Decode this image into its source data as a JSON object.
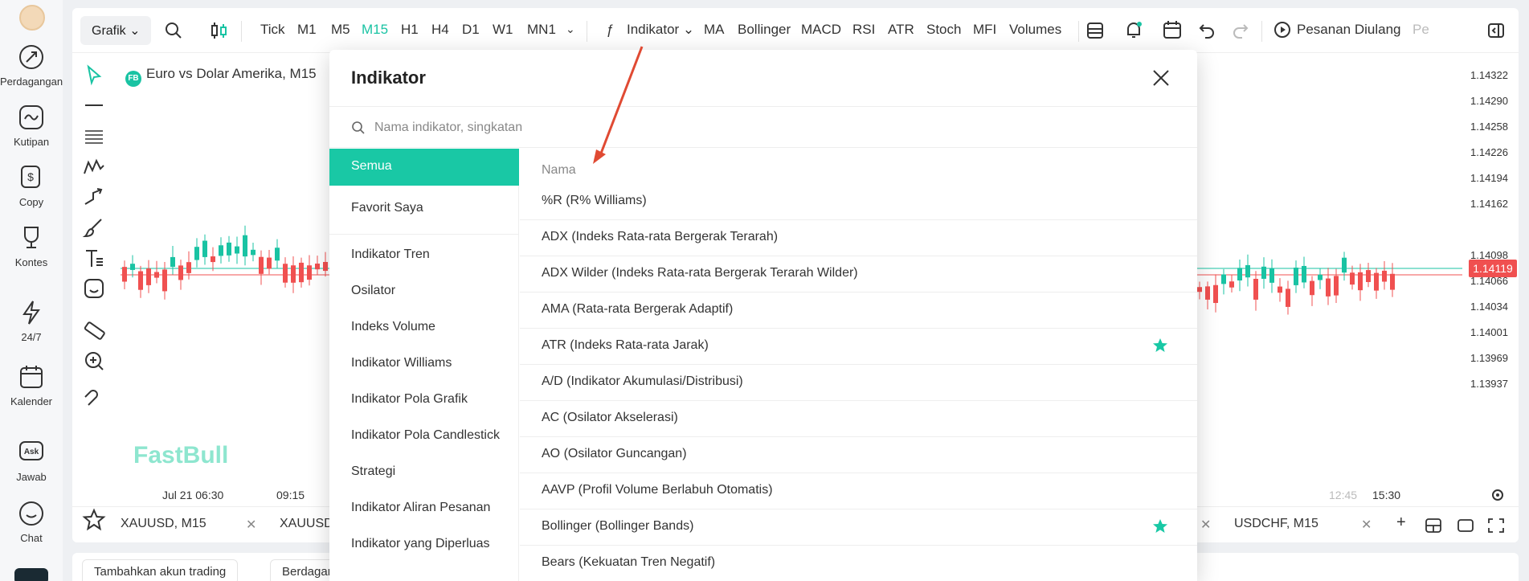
{
  "app_sidebar": {
    "items": [
      {
        "label": "Perdagangan",
        "icon": "trade-compass-icon"
      },
      {
        "label": "Kutipan",
        "icon": "quote-chart-icon"
      },
      {
        "label": "Copy",
        "icon": "copy-dollar-icon"
      },
      {
        "label": "Kontes",
        "icon": "trophy-icon"
      },
      {
        "label": "24/7",
        "icon": "lightning-icon"
      },
      {
        "label": "Kalender",
        "icon": "calendar-icon"
      },
      {
        "label": "Jawab",
        "icon": "ask-icon"
      },
      {
        "label": "Chat",
        "icon": "chat-icon"
      }
    ]
  },
  "toolbar": {
    "grafik": "Grafik",
    "timeframes": [
      "Tick",
      "M1",
      "M5",
      "M15",
      "H1",
      "H4",
      "D1",
      "W1",
      "MN1"
    ],
    "active_timeframe": "M15",
    "indikator": "Indikator",
    "quick_indicators": [
      "MA",
      "Bollinger",
      "MACD",
      "RSI",
      "ATR",
      "Stoch",
      "MFI",
      "Volumes"
    ],
    "pesanan_diulang": "Pesanan Diulang",
    "pe": "Pe"
  },
  "chart": {
    "title": "Euro vs Dolar Amerika, M15",
    "badge": "FB",
    "brand": "FastBull",
    "prices": [
      "1.14322",
      "1.14290",
      "1.14258",
      "1.14226",
      "1.14194",
      "1.14162",
      "1.14098",
      "1.14066",
      "1.14034",
      "1.14001",
      "1.13969",
      "1.13937"
    ],
    "current_price": "1.14119",
    "time_labels": [
      "Jul 21 06:30",
      "09:15",
      "12:45",
      "15:30"
    ]
  },
  "symbol_tabs": [
    "XAUUSD, M15",
    "XAUUSD",
    "USDCHF, M15"
  ],
  "bottom_tabs": [
    "Tambahkan akun trading",
    "Berdagan"
  ],
  "modal": {
    "title": "Indikator",
    "search_placeholder": "Nama indikator, singkatan",
    "categories": [
      "Semua",
      "Favorit Saya",
      "Indikator Tren",
      "Osilator",
      "Indeks Volume",
      "Indikator Williams",
      "Indikator Pola Grafik",
      "Indikator Pola Candlestick",
      "Strategi",
      "Indikator Aliran Pesanan",
      "Indikator yang Diperluas"
    ],
    "active_category": "Semua",
    "column_header": "Nama",
    "indicators": [
      {
        "name": "%R (R% Williams)",
        "favorite": false
      },
      {
        "name": "ADX (Indeks Rata-rata Bergerak Terarah)",
        "favorite": false
      },
      {
        "name": "ADX Wilder (Indeks Rata-rata Bergerak Terarah Wilder)",
        "favorite": false
      },
      {
        "name": "AMA (Rata-rata Bergerak Adaptif)",
        "favorite": false
      },
      {
        "name": "ATR (Indeks Rata-rata Jarak)",
        "favorite": true
      },
      {
        "name": "A/D (Indikator Akumulasi/Distribusi)",
        "favorite": false
      },
      {
        "name": "AC (Osilator Akselerasi)",
        "favorite": false
      },
      {
        "name": "AO (Osilator Guncangan)",
        "favorite": false
      },
      {
        "name": "AAVP (Profil Volume Berlabuh Otomatis)",
        "favorite": false
      },
      {
        "name": "Bollinger (Bollinger Bands)",
        "favorite": true
      },
      {
        "name": "Bears (Kekuatan Tren Negatif)",
        "favorite": false
      }
    ]
  },
  "colors": {
    "accent": "#19c8a5",
    "up_candle": "#19c3a3",
    "down_candle": "#f05050",
    "annotation_arrow": "#e04a33"
  }
}
